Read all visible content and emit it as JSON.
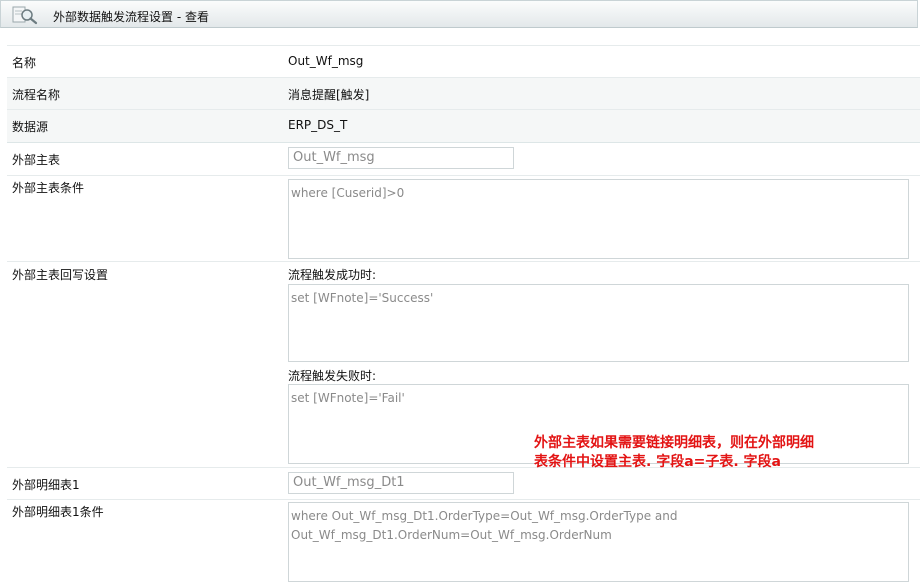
{
  "window": {
    "title": "外部数据触发流程设置 - 查看",
    "icon": "magnifier-icon"
  },
  "rows": {
    "name": {
      "label": "名称",
      "value": "Out_Wf_msg"
    },
    "flow_name": {
      "label": "流程名称",
      "value": "消息提醒[触发]"
    },
    "data_source": {
      "label": "数据源",
      "value": "ERP_DS_T"
    },
    "main_table": {
      "label": "外部主表",
      "value": "Out_Wf_msg"
    },
    "main_condition": {
      "label": "外部主表条件",
      "value": "where [Cuserid]>0"
    },
    "writeback": {
      "label": "外部主表回写设置",
      "success_label": "流程触发成功时:",
      "success_value": "set [WFnote]='Success'",
      "fail_label": "流程触发失败时:",
      "fail_value": "set [WFnote]='Fail'"
    },
    "detail_table": {
      "label": "外部明细表1",
      "value": "Out_Wf_msg_Dt1"
    },
    "detail_condition": {
      "label": "外部明细表1条件",
      "value": "where Out_Wf_msg_Dt1.OrderType=Out_Wf_msg.OrderType and\nOut_Wf_msg_Dt1.OrderNum=Out_Wf_msg.OrderNum"
    }
  },
  "annotation": {
    "line1": "外部主表如果需要链接明细表，则在外部明细",
    "line2": "表条件中设置主表. 字段a=子表. 字段a",
    "color": "#e31414"
  }
}
